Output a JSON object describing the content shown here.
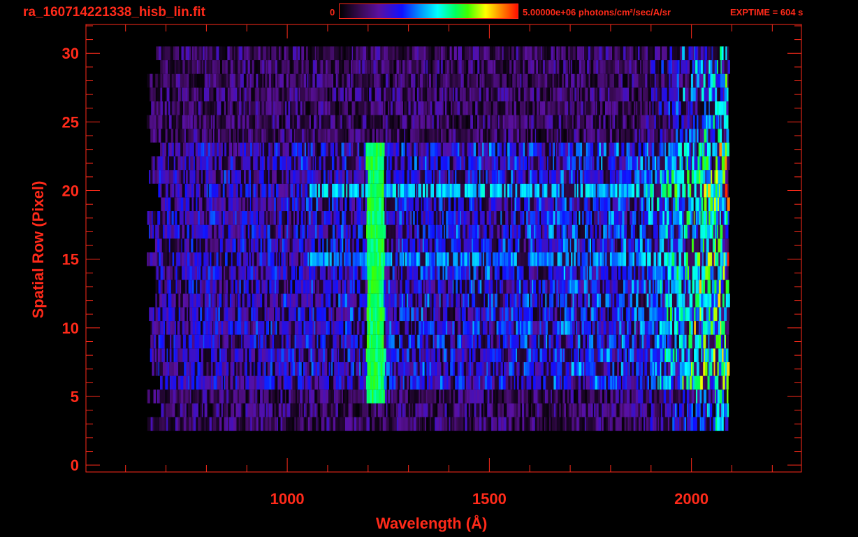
{
  "chart_data": {
    "type": "heatmap",
    "title": "ra_160714221338_hisb_lin.fit",
    "xlabel": "Wavelength (Å)",
    "ylabel": "Spatial Row (Pixel)",
    "xlim": [
      502,
      2272
    ],
    "ylim": [
      -0.5,
      32.1
    ],
    "xticks": [
      1000,
      1500,
      2000
    ],
    "xtick_labels": [
      "1000",
      "1500",
      "2000"
    ],
    "yticks": [
      0,
      5,
      10,
      15,
      20,
      25,
      30
    ],
    "ytick_labels": [
      "0",
      "5",
      "10",
      "15",
      "20",
      "25",
      "30"
    ],
    "colorbar": {
      "min_label": "0",
      "max_label": "5.00000e+06 photons/cm²/sec/A/sr",
      "range": [
        0,
        5000000
      ],
      "colormap": "rainbow"
    },
    "annotation": "EXPTIME = 604 s",
    "data_extent": {
      "wavelength_range": [
        650,
        2090
      ],
      "rows": [
        3,
        30
      ]
    },
    "features": {
      "emission_line": {
        "wavelength": 1216,
        "rows": [
          5,
          23
        ],
        "level": 0.6
      },
      "bright_rows": [
        {
          "row": 15,
          "level": 0.45
        },
        {
          "row": 20,
          "level": 0.5
        }
      ],
      "signal_rows": [
        6,
        23
      ],
      "red_end_rise": {
        "start": 1850,
        "end": 2070,
        "level": 0.5
      }
    }
  },
  "colors": {
    "axis": "#ff2a1a",
    "background": "#000000"
  }
}
